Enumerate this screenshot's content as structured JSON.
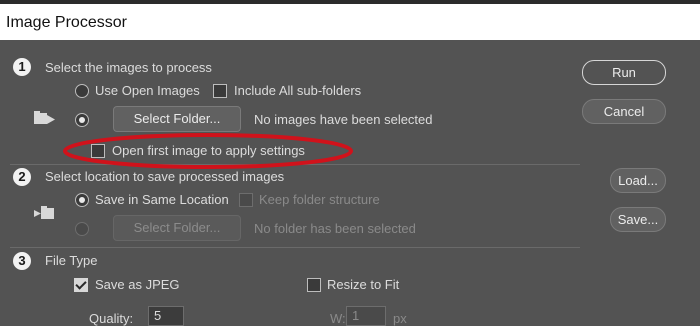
{
  "window": {
    "title": "Image Processor"
  },
  "section1": {
    "number": "1",
    "heading": "Select the images to process",
    "use_open_images": "Use Open Images",
    "include_subfolders": "Include All sub-folders",
    "select_folder": "Select Folder...",
    "status": "No images have been selected",
    "open_first_image": "Open first image to apply settings"
  },
  "section2": {
    "number": "2",
    "heading": "Select location to save processed images",
    "save_same_location": "Save in Same Location",
    "keep_structure": "Keep folder structure",
    "select_folder": "Select Folder...",
    "status": "No folder has been selected"
  },
  "section3": {
    "number": "3",
    "heading": "File Type",
    "save_as_jpeg": "Save as JPEG",
    "resize_to_fit": "Resize to Fit",
    "quality_label": "Quality:",
    "quality_value": "5",
    "width_label": "W:",
    "width_value": "1",
    "unit": "px"
  },
  "buttons": {
    "run": "Run",
    "cancel": "Cancel",
    "load": "Load...",
    "save": "Save..."
  },
  "colors": {
    "dialog_bg": "#535353",
    "highlight_ellipse": "#d0121b"
  }
}
